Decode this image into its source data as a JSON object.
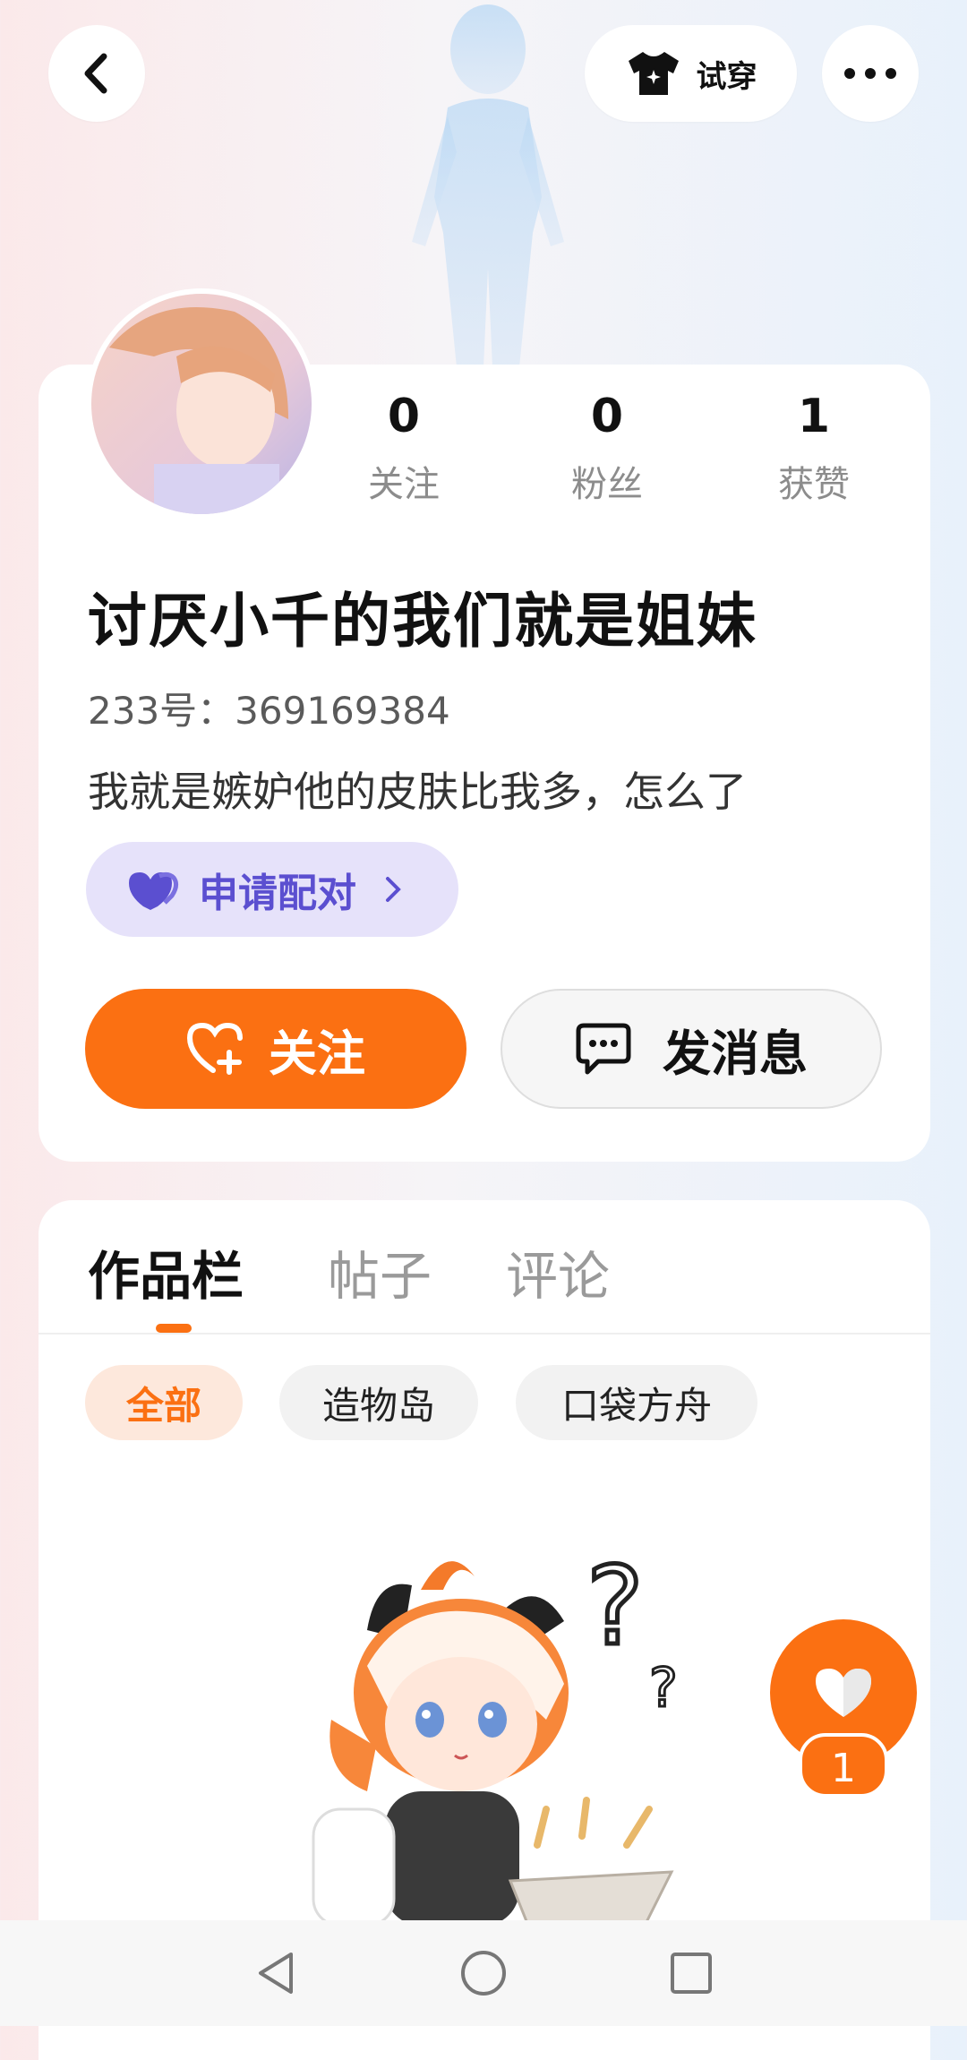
{
  "header": {
    "try_on_label": "试穿"
  },
  "profile": {
    "stats": [
      {
        "value": "0",
        "label": "关注"
      },
      {
        "value": "0",
        "label": "粉丝"
      },
      {
        "value": "1",
        "label": "获赞"
      }
    ],
    "nickname": "讨厌小千的我们就是姐妹",
    "uid_text": "233号：369169384",
    "bio": "我就是嫉妒他的皮肤比我多，怎么了",
    "pair_label": "申请配对",
    "follow_label": "关注",
    "message_label": "发消息"
  },
  "tabs": [
    {
      "label": "作品栏",
      "active": true
    },
    {
      "label": "帖子",
      "active": false
    },
    {
      "label": "评论",
      "active": false
    }
  ],
  "filters": [
    {
      "label": "全部",
      "active": true
    },
    {
      "label": "造物岛",
      "active": false
    },
    {
      "label": "口袋方舟",
      "active": false
    }
  ],
  "like_count": "1",
  "colors": {
    "accent": "#fb7012",
    "pair_bg": "#e6e2fa",
    "pair_text": "#5b4fd0"
  },
  "icons": [
    "back-icon",
    "shirt-icon",
    "more-icon",
    "heart-icon",
    "heart-plus-icon",
    "chat-icon",
    "chevron-right-icon",
    "nav-back-icon",
    "nav-home-icon",
    "nav-recents-icon"
  ]
}
